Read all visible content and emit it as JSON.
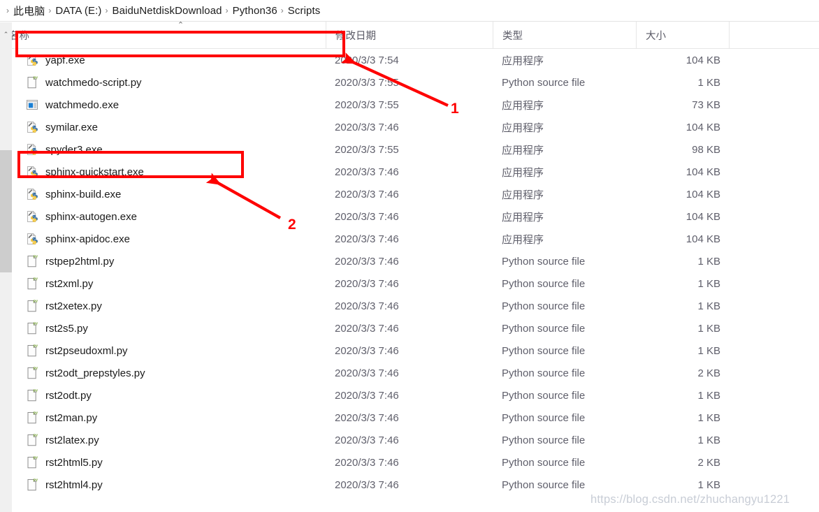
{
  "breadcrumb": {
    "separator": "›",
    "items": [
      "此电脑",
      "DATA (E:)",
      "BaiduNetdiskDownload",
      "Python36",
      "Scripts"
    ]
  },
  "columns": {
    "name": "名称",
    "date": "修改日期",
    "type": "类型",
    "size": "大小",
    "sort_indicator": "⌃"
  },
  "scrollbar": {
    "up_arrow": "⌃"
  },
  "types": {
    "application": "应用程序",
    "python_source": "Python source file"
  },
  "files": [
    {
      "name": "yapf.exe",
      "date": "2020/3/3 7:54",
      "type": "应用程序",
      "size": "104 KB",
      "icon": "python-exe-icon"
    },
    {
      "name": "watchmedo-script.py",
      "date": "2020/3/3 7:55",
      "type": "Python source file",
      "size": "1 KB",
      "icon": "python-source-icon"
    },
    {
      "name": "watchmedo.exe",
      "date": "2020/3/3 7:55",
      "type": "应用程序",
      "size": "73 KB",
      "icon": "application-icon"
    },
    {
      "name": "symilar.exe",
      "date": "2020/3/3 7:46",
      "type": "应用程序",
      "size": "104 KB",
      "icon": "python-exe-icon"
    },
    {
      "name": "spyder3.exe",
      "date": "2020/3/3 7:55",
      "type": "应用程序",
      "size": "98 KB",
      "icon": "python-exe-icon"
    },
    {
      "name": "sphinx-quickstart.exe",
      "date": "2020/3/3 7:46",
      "type": "应用程序",
      "size": "104 KB",
      "icon": "python-exe-icon"
    },
    {
      "name": "sphinx-build.exe",
      "date": "2020/3/3 7:46",
      "type": "应用程序",
      "size": "104 KB",
      "icon": "python-exe-icon"
    },
    {
      "name": "sphinx-autogen.exe",
      "date": "2020/3/3 7:46",
      "type": "应用程序",
      "size": "104 KB",
      "icon": "python-exe-icon"
    },
    {
      "name": "sphinx-apidoc.exe",
      "date": "2020/3/3 7:46",
      "type": "应用程序",
      "size": "104 KB",
      "icon": "python-exe-icon"
    },
    {
      "name": "rstpep2html.py",
      "date": "2020/3/3 7:46",
      "type": "Python source file",
      "size": "1 KB",
      "icon": "python-source-icon"
    },
    {
      "name": "rst2xml.py",
      "date": "2020/3/3 7:46",
      "type": "Python source file",
      "size": "1 KB",
      "icon": "python-source-icon"
    },
    {
      "name": "rst2xetex.py",
      "date": "2020/3/3 7:46",
      "type": "Python source file",
      "size": "1 KB",
      "icon": "python-source-icon"
    },
    {
      "name": "rst2s5.py",
      "date": "2020/3/3 7:46",
      "type": "Python source file",
      "size": "1 KB",
      "icon": "python-source-icon"
    },
    {
      "name": "rst2pseudoxml.py",
      "date": "2020/3/3 7:46",
      "type": "Python source file",
      "size": "1 KB",
      "icon": "python-source-icon"
    },
    {
      "name": "rst2odt_prepstyles.py",
      "date": "2020/3/3 7:46",
      "type": "Python source file",
      "size": "2 KB",
      "icon": "python-source-icon"
    },
    {
      "name": "rst2odt.py",
      "date": "2020/3/3 7:46",
      "type": "Python source file",
      "size": "1 KB",
      "icon": "python-source-icon"
    },
    {
      "name": "rst2man.py",
      "date": "2020/3/3 7:46",
      "type": "Python source file",
      "size": "1 KB",
      "icon": "python-source-icon"
    },
    {
      "name": "rst2latex.py",
      "date": "2020/3/3 7:46",
      "type": "Python source file",
      "size": "1 KB",
      "icon": "python-source-icon"
    },
    {
      "name": "rst2html5.py",
      "date": "2020/3/3 7:46",
      "type": "Python source file",
      "size": "2 KB",
      "icon": "python-source-icon"
    },
    {
      "name": "rst2html4.py",
      "date": "2020/3/3 7:46",
      "type": "Python source file",
      "size": "1 KB",
      "icon": "python-source-icon"
    }
  ],
  "annotations": {
    "accent_color": "#fe0000",
    "marker_1": "1",
    "marker_2": "2"
  },
  "watermark": "https://blog.csdn.net/zhuchangyu1221"
}
